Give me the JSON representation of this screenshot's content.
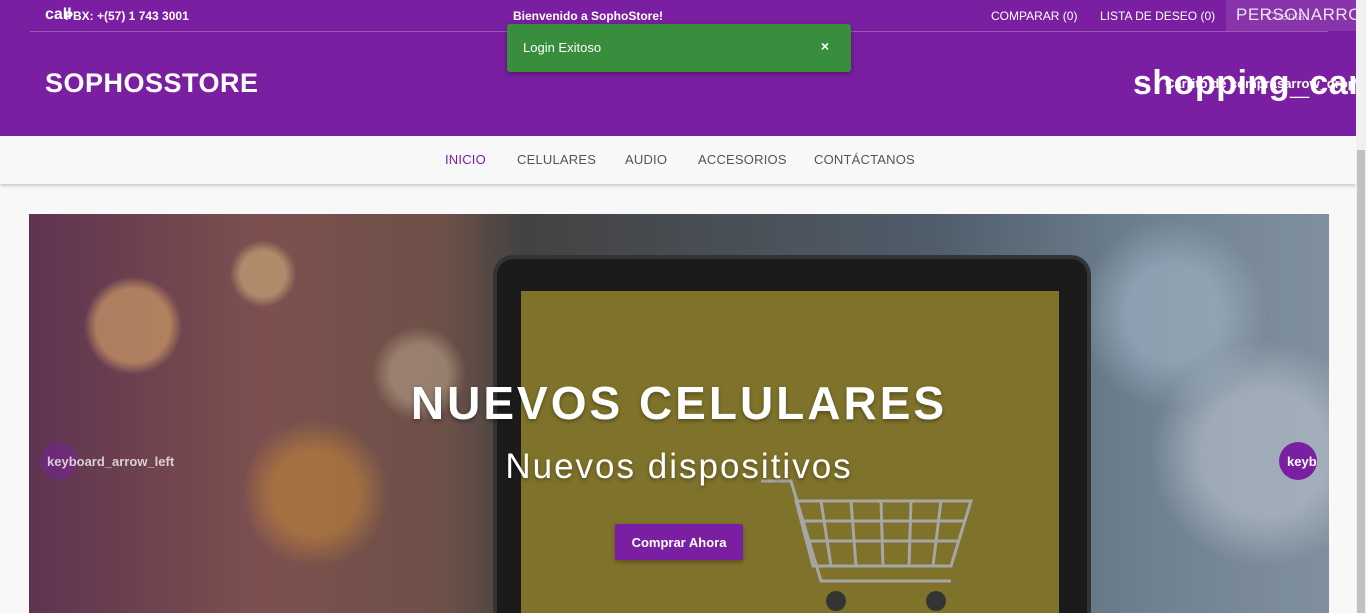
{
  "topbar": {
    "call_icon": "call",
    "phone": "PBX: +(57) 1 743 3001",
    "welcome": "Bienvenido a SophoStore!",
    "compare": "COMPARAR (0)",
    "wishlist": "LISTA DE DESEO (0)",
    "account_icon": "PERSON",
    "account_arrow": "ARROW",
    "account_sub": "Cuenta",
    "brand": "SOPHOSSTORE",
    "cart_icon": "shopping_cart",
    "cart_label": "Carrito de compras",
    "cart_arrow": "arrow_drop_down"
  },
  "toast": {
    "message": "Login Exitoso",
    "close": "×",
    "color": "#388e3c"
  },
  "nav": {
    "items": [
      "INICIO",
      "CELULARES",
      "AUDIO",
      "ACCESORIOS",
      "CONTÁCTANOS"
    ],
    "active": "INICIO"
  },
  "hero": {
    "title": "NUEVOS CELULARES",
    "subtitle": "Nuevos dispositivos",
    "button": "Comprar Ahora",
    "prev_icon": "keyboard_arrow_left",
    "next_icon": "keyboard_arrow_right"
  },
  "colors": {
    "brand": "#7b1fa2",
    "success": "#388e3c"
  }
}
